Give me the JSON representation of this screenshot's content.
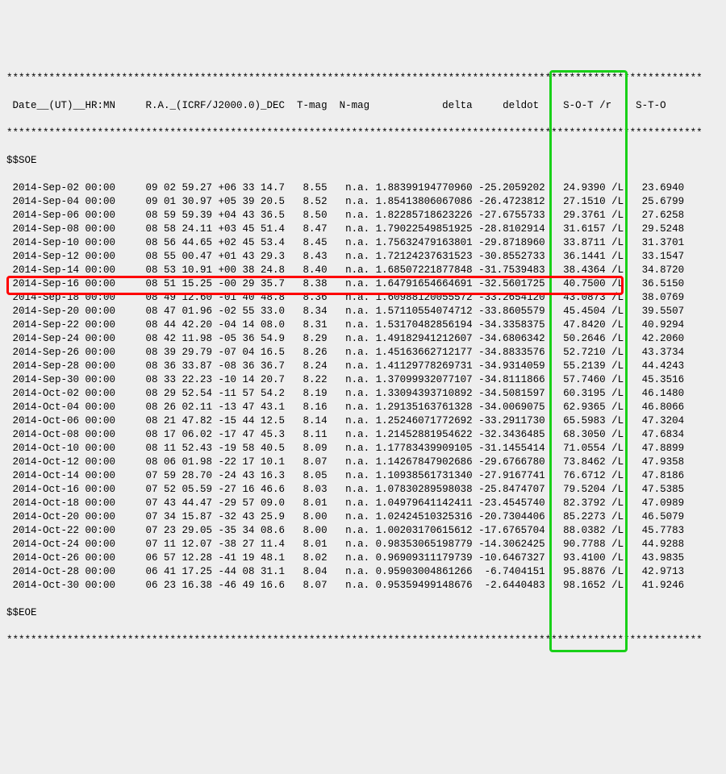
{
  "stars_full": "*******************************************************************************************************************",
  "header": " Date__(UT)__HR:MN     R.A._(ICRF/J2000.0)_DEC  T-mag  N-mag            delta     deldot    S-O-T /r    S-T-O",
  "soe": "$$SOE",
  "eoe": "$$EOE",
  "rows": [
    " 2014-Sep-02 00:00     09 02 59.27 +06 33 14.7   8.55   n.a. 1.88399194770960 -25.2059202   24.9390 /L   23.6940",
    " 2014-Sep-04 00:00     09 01 30.97 +05 39 20.5   8.52   n.a. 1.85413806067086 -26.4723812   27.1510 /L   25.6799",
    " 2014-Sep-06 00:00     08 59 59.39 +04 43 36.5   8.50   n.a. 1.82285718623226 -27.6755733   29.3761 /L   27.6258",
    " 2014-Sep-08 00:00     08 58 24.11 +03 45 51.4   8.47   n.a. 1.79022549851925 -28.8102914   31.6157 /L   29.5248",
    " 2014-Sep-10 00:00     08 56 44.65 +02 45 53.4   8.45   n.a. 1.75632479163801 -29.8718960   33.8711 /L   31.3701",
    " 2014-Sep-12 00:00     08 55 00.47 +01 43 29.3   8.43   n.a. 1.72124237631523 -30.8552733   36.1441 /L   33.1547",
    " 2014-Sep-14 00:00     08 53 10.91 +00 38 24.8   8.40   n.a. 1.68507221877848 -31.7539483   38.4364 /L   34.8720",
    " 2014-Sep-16 00:00     08 51 15.25 -00 29 35.7   8.38   n.a. 1.64791654664691 -32.5601725   40.7500 /L   36.5150",
    " 2014-Sep-18 00:00     08 49 12.60 -01 40 48.8   8.36   n.a. 1.60988120055572 -33.2654120   43.0873 /L   38.0769",
    " 2014-Sep-20 00:00     08 47 01.96 -02 55 33.0   8.34   n.a. 1.57110554074712 -33.8605579   45.4504 /L   39.5507",
    " 2014-Sep-22 00:00     08 44 42.20 -04 14 08.0   8.31   n.a. 1.53170482856194 -34.3358375   47.8420 /L   40.9294",
    " 2014-Sep-24 00:00     08 42 11.98 -05 36 54.9   8.29   n.a. 1.49182941212607 -34.6806342   50.2646 /L   42.2060",
    " 2014-Sep-26 00:00     08 39 29.79 -07 04 16.5   8.26   n.a. 1.45163662712177 -34.8833576   52.7210 /L   43.3734",
    " 2014-Sep-28 00:00     08 36 33.87 -08 36 36.7   8.24   n.a. 1.41129778269731 -34.9314059   55.2139 /L   44.4243",
    " 2014-Sep-30 00:00     08 33 22.23 -10 14 20.7   8.22   n.a. 1.37099932077107 -34.8111866   57.7460 /L   45.3516",
    " 2014-Oct-02 00:00     08 29 52.54 -11 57 54.2   8.19   n.a. 1.33094393710892 -34.5081597   60.3195 /L   46.1480",
    " 2014-Oct-04 00:00     08 26 02.11 -13 47 43.1   8.16   n.a. 1.29135163761328 -34.0069075   62.9365 /L   46.8066",
    " 2014-Oct-06 00:00     08 21 47.82 -15 44 12.5   8.14   n.a. 1.25246071772692 -33.2911730   65.5983 /L   47.3204",
    " 2014-Oct-08 00:00     08 17 06.02 -17 47 45.3   8.11   n.a. 1.21452881954622 -32.3436485   68.3050 /L   47.6834",
    " 2014-Oct-10 00:00     08 11 52.43 -19 58 40.5   8.09   n.a. 1.17783439909105 -31.1455414   71.0554 /L   47.8899",
    " 2014-Oct-12 00:00     08 06 01.98 -22 17 10.1   8.07   n.a. 1.14267847902686 -29.6766780   73.8462 /L   47.9358",
    " 2014-Oct-14 00:00     07 59 28.70 -24 43 16.3   8.05   n.a. 1.10938561731340 -27.9167741   76.6712 /L   47.8186",
    " 2014-Oct-16 00:00     07 52 05.59 -27 16 46.6   8.03   n.a. 1.07830289598038 -25.8474707   79.5204 /L   47.5385",
    " 2014-Oct-18 00:00     07 43 44.47 -29 57 09.0   8.01   n.a. 1.04979641142411 -23.4545740   82.3792 /L   47.0989",
    " 2014-Oct-20 00:00     07 34 15.87 -32 43 25.9   8.00   n.a. 1.02424510325316 -20.7304406   85.2273 /L   46.5079",
    " 2014-Oct-22 00:00     07 23 29.05 -35 34 08.6   8.00   n.a. 1.00203170615612 -17.6765704   88.0382 /L   45.7783",
    " 2014-Oct-24 00:00     07 11 12.07 -38 27 11.4   8.01   n.a. 0.98353065198779 -14.3062425   90.7788 /L   44.9288",
    " 2014-Oct-26 00:00     06 57 12.28 -41 19 48.1   8.02   n.a. 0.96909311179739 -10.6467327   93.4100 /L   43.9835",
    " 2014-Oct-28 00:00     06 41 17.25 -44 08 31.1   8.04   n.a. 0.95903004861266  -6.7404151   95.8876 /L   42.9713",
    " 2014-Oct-30 00:00     06 23 16.38 -46 49 16.6   8.07   n.a. 0.95359499148676  -2.6440483   98.1652 /L   41.9246"
  ],
  "highlight_row_index": 7,
  "chart_data": {
    "type": "table",
    "columns": [
      "Date__(UT)__HR:MN",
      "R.A._(ICRF/J2000.0)_DEC",
      "T-mag",
      "N-mag",
      "delta",
      "deldot",
      "S-O-T /r",
      "S-T-O"
    ],
    "highlighted_row": {
      "date": "2014-Sep-16 00:00",
      "ra_dec": "08 51 15.25 -00 29 35.7",
      "t_mag": 8.38,
      "n_mag": "n.a.",
      "delta": 1.64791654664691,
      "deldot": -32.5601725,
      "s_o_t": "40.7500 /L",
      "s_t_o": 36.515
    },
    "highlighted_column": "S-O-T /r"
  }
}
